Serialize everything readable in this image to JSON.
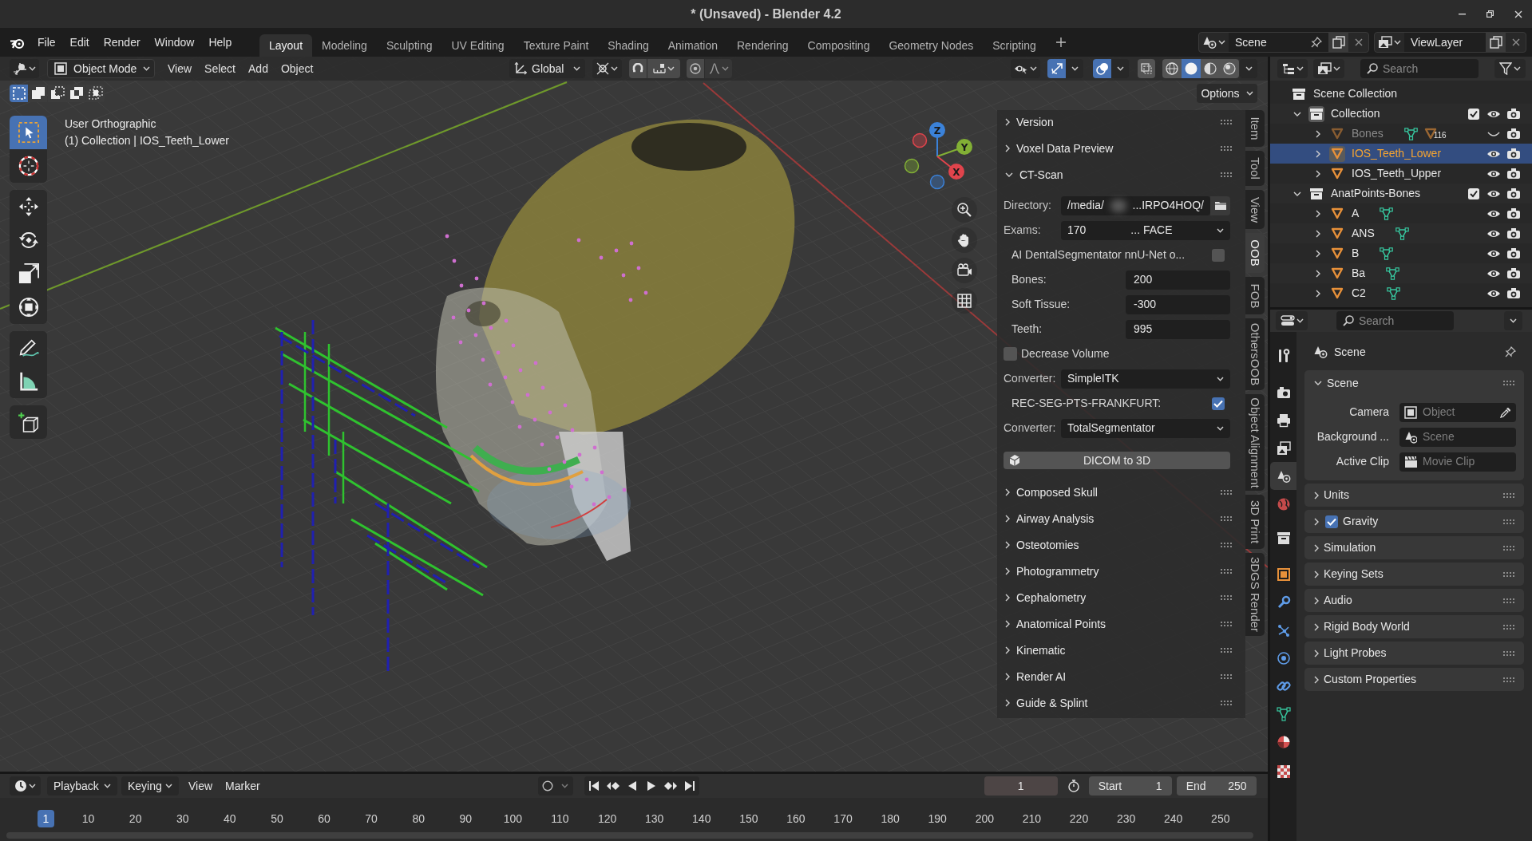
{
  "window": {
    "title": "* (Unsaved) - Blender 4.2"
  },
  "top_bar": {
    "menus": [
      "File",
      "Edit",
      "Render",
      "Window",
      "Help"
    ],
    "workspaces": [
      {
        "label": "Layout",
        "selected": true
      },
      {
        "label": "Modeling",
        "selected": false
      },
      {
        "label": "Sculpting",
        "selected": false
      },
      {
        "label": "UV Editing",
        "selected": false
      },
      {
        "label": "Texture Paint",
        "selected": false
      },
      {
        "label": "Shading",
        "selected": false
      },
      {
        "label": "Animation",
        "selected": false
      },
      {
        "label": "Rendering",
        "selected": false
      },
      {
        "label": "Compositing",
        "selected": false
      },
      {
        "label": "Geometry Nodes",
        "selected": false
      },
      {
        "label": "Scripting",
        "selected": false
      }
    ],
    "scene": "Scene",
    "view_layer": "ViewLayer"
  },
  "viewport_header": {
    "mode": "Object Mode",
    "menus": [
      "View",
      "Select",
      "Add",
      "Object"
    ],
    "orientation": "Global",
    "snap": false,
    "proportional_editing": false,
    "gizmos": true,
    "overlays": true,
    "xray": false,
    "shading": [
      {
        "kind": "wireframe",
        "selected": false
      },
      {
        "kind": "solid",
        "selected": true
      },
      {
        "kind": "material",
        "selected": false
      },
      {
        "kind": "rendered",
        "selected": false
      }
    ]
  },
  "tool_settings": {
    "select_modes": [
      {
        "kind": "set",
        "selected": true
      },
      {
        "kind": "extend",
        "selected": false
      },
      {
        "kind": "subtract",
        "selected": false
      },
      {
        "kind": "difference",
        "selected": false
      },
      {
        "kind": "intersect",
        "selected": false
      }
    ],
    "options": "Options"
  },
  "toolbar": [
    {
      "kind": "select_box",
      "selected": true
    },
    {
      "kind": "cursor",
      "selected": false
    },
    {
      "kind": "move",
      "selected": false
    },
    {
      "kind": "rotate",
      "selected": false
    },
    {
      "kind": "scale",
      "selected": false
    },
    {
      "kind": "transform",
      "selected": false
    },
    {
      "kind": "annotate",
      "selected": false
    },
    {
      "kind": "measure",
      "selected": false
    },
    {
      "kind": "add_cube",
      "selected": false
    }
  ],
  "viewport": {
    "view_name": "User Orthographic",
    "object_info": "(1) Collection | IOS_Teeth_Lower",
    "navigation_gizmo": [
      {
        "kind": "z",
        "label": "Z",
        "color": "#3b82d9"
      },
      {
        "kind": "y",
        "label": "Y",
        "color": "#82b035"
      },
      {
        "kind": "x",
        "label": "X",
        "color": "#e0444c"
      }
    ]
  },
  "sidebar": {
    "tabs": [
      {
        "label": "Item",
        "selected": false
      },
      {
        "label": "Tool",
        "selected": false
      },
      {
        "label": "View",
        "selected": false
      },
      {
        "label": "OOB",
        "selected": true
      },
      {
        "label": "FOB",
        "selected": false
      },
      {
        "label": "OthersOOB",
        "selected": false
      },
      {
        "label": "Object Alignment",
        "selected": false
      },
      {
        "label": "3D Print",
        "selected": false
      },
      {
        "label": "3DGS Render",
        "selected": false
      }
    ],
    "panels": [
      {
        "title": "Version",
        "expanded": false
      },
      {
        "title": "Voxel Data Preview",
        "expanded": false
      },
      {
        "title": "CT-Scan",
        "expanded": true,
        "rows": [
          {
            "kind": "path",
            "label": "Directory:",
            "value_parts": [
              "/media/",
              "...IRPO4HOQ/"
            ],
            "redacted": true
          },
          {
            "kind": "dropdown",
            "label": "Exams:",
            "value_parts": [
              "170",
              "... FACE"
            ]
          },
          {
            "kind": "toggle_right",
            "label": "AI DentalSegmentator nnU-Net o...",
            "checked": false
          },
          {
            "kind": "number",
            "label": "Bones:",
            "value": "200"
          },
          {
            "kind": "number",
            "label": "Soft Tissue:",
            "value": "-300"
          },
          {
            "kind": "number",
            "label": "Teeth:",
            "value": "995"
          },
          {
            "kind": "toggle_left",
            "label": "Decrease Volume",
            "checked": false
          },
          {
            "kind": "dropdown",
            "label": "Converter:",
            "value_parts": [
              "SimpleITK"
            ]
          },
          {
            "kind": "toggle_right",
            "label": "REC-SEG-PTS-FRANKFURT:",
            "checked": true
          },
          {
            "kind": "dropdown",
            "label": "Converter:",
            "value_parts": [
              "TotalSegmentator"
            ]
          },
          {
            "kind": "button",
            "label": "DICOM to 3D"
          }
        ]
      },
      {
        "title": "Composed Skull",
        "expanded": false
      },
      {
        "title": "Airway Analysis",
        "expanded": false
      },
      {
        "title": "Osteotomies",
        "expanded": false
      },
      {
        "title": "Photogrammetry",
        "expanded": false
      },
      {
        "title": "Cephalometry",
        "expanded": false
      },
      {
        "title": "Anatomical Points",
        "expanded": false
      },
      {
        "title": "Kinematic",
        "expanded": false
      },
      {
        "title": "Render AI",
        "expanded": false
      },
      {
        "title": "Guide & Splint",
        "expanded": false
      }
    ]
  },
  "outliner": {
    "search_placeholder": "Search",
    "tree": [
      {
        "kind": "scene_collection",
        "label": "Scene Collection",
        "children": [
          {
            "kind": "collection",
            "label": "Collection",
            "expanded": true,
            "active": true,
            "included": true,
            "visible": true,
            "children": [
              {
                "kind": "object",
                "label": "Bones",
                "expanded": false,
                "selected": false,
                "visible": false,
                "show_mesh_data": true,
                "child_count": "116"
              },
              {
                "kind": "object",
                "label": "IOS_Teeth_Lower",
                "expanded": false,
                "selected": true,
                "visible": true,
                "show_mesh_data": false
              },
              {
                "kind": "object",
                "label": "IOS_Teeth_Upper",
                "expanded": false,
                "selected": false,
                "visible": true,
                "show_mesh_data": false
              }
            ]
          },
          {
            "kind": "collection",
            "label": "AnatPoints-Bones",
            "expanded": true,
            "active": false,
            "included": true,
            "visible": true,
            "children": [
              {
                "kind": "object",
                "label": "A",
                "expanded": false,
                "selected": false,
                "visible": true,
                "show_mesh_data": true
              },
              {
                "kind": "object",
                "label": "ANS",
                "expanded": false,
                "selected": false,
                "visible": true,
                "show_mesh_data": true
              },
              {
                "kind": "object",
                "label": "B",
                "expanded": false,
                "selected": false,
                "visible": true,
                "show_mesh_data": true
              },
              {
                "kind": "object",
                "label": "Ba",
                "expanded": false,
                "selected": false,
                "visible": true,
                "show_mesh_data": true
              },
              {
                "kind": "object",
                "label": "C2",
                "expanded": false,
                "selected": false,
                "visible": true,
                "show_mesh_data": true
              }
            ]
          }
        ]
      }
    ]
  },
  "properties": {
    "search_placeholder": "Search",
    "tabs": [
      {
        "kind": "tool",
        "selected": false
      },
      {
        "kind": "render",
        "selected": false
      },
      {
        "kind": "output",
        "selected": false
      },
      {
        "kind": "view_layer",
        "selected": false
      },
      {
        "kind": "scene",
        "selected": true
      },
      {
        "kind": "world",
        "selected": false
      },
      {
        "kind": "collection",
        "selected": false
      },
      {
        "kind": "object",
        "selected": false
      },
      {
        "kind": "modifiers",
        "selected": false
      },
      {
        "kind": "particles",
        "selected": false
      },
      {
        "kind": "physics",
        "selected": false
      },
      {
        "kind": "constraints",
        "selected": false
      },
      {
        "kind": "data",
        "selected": false
      },
      {
        "kind": "material",
        "selected": false
      },
      {
        "kind": "texture",
        "selected": false
      }
    ],
    "context": "Scene",
    "panels": [
      {
        "kind": "plain",
        "title": "Scene",
        "expanded": true,
        "fields": [
          {
            "kind": "object",
            "label": "Camera",
            "placeholder": "Object"
          },
          {
            "kind": "scene",
            "label": "Background ...",
            "placeholder": "Scene"
          },
          {
            "kind": "clip",
            "label": "Active Clip",
            "placeholder": "Movie Clip"
          }
        ]
      },
      {
        "kind": "plain",
        "title": "Units",
        "expanded": false
      },
      {
        "kind": "toggle",
        "title": "Gravity",
        "expanded": false,
        "checked": true
      },
      {
        "kind": "plain",
        "title": "Simulation",
        "expanded": false
      },
      {
        "kind": "plain",
        "title": "Keying Sets",
        "expanded": false
      },
      {
        "kind": "plain",
        "title": "Audio",
        "expanded": false
      },
      {
        "kind": "plain",
        "title": "Rigid Body World",
        "expanded": false
      },
      {
        "kind": "plain",
        "title": "Light Probes",
        "expanded": false
      },
      {
        "kind": "plain",
        "title": "Custom Properties",
        "expanded": false
      }
    ]
  },
  "timeline": {
    "menus": [
      {
        "label": "Playback",
        "dropdown": true
      },
      {
        "label": "Keying",
        "dropdown": true
      },
      {
        "label": "View",
        "dropdown": false
      },
      {
        "label": "Marker",
        "dropdown": false
      }
    ],
    "auto_keying": false,
    "current_frame": "1",
    "start_label": "Start",
    "start": "1",
    "end_label": "End",
    "end": "250",
    "playhead": "1",
    "ruler": [
      "10",
      "20",
      "30",
      "40",
      "50",
      "60",
      "70",
      "80",
      "90",
      "100",
      "110",
      "120",
      "130",
      "140",
      "150",
      "160",
      "170",
      "180",
      "190",
      "200",
      "210",
      "220",
      "230",
      "240",
      "250"
    ]
  }
}
